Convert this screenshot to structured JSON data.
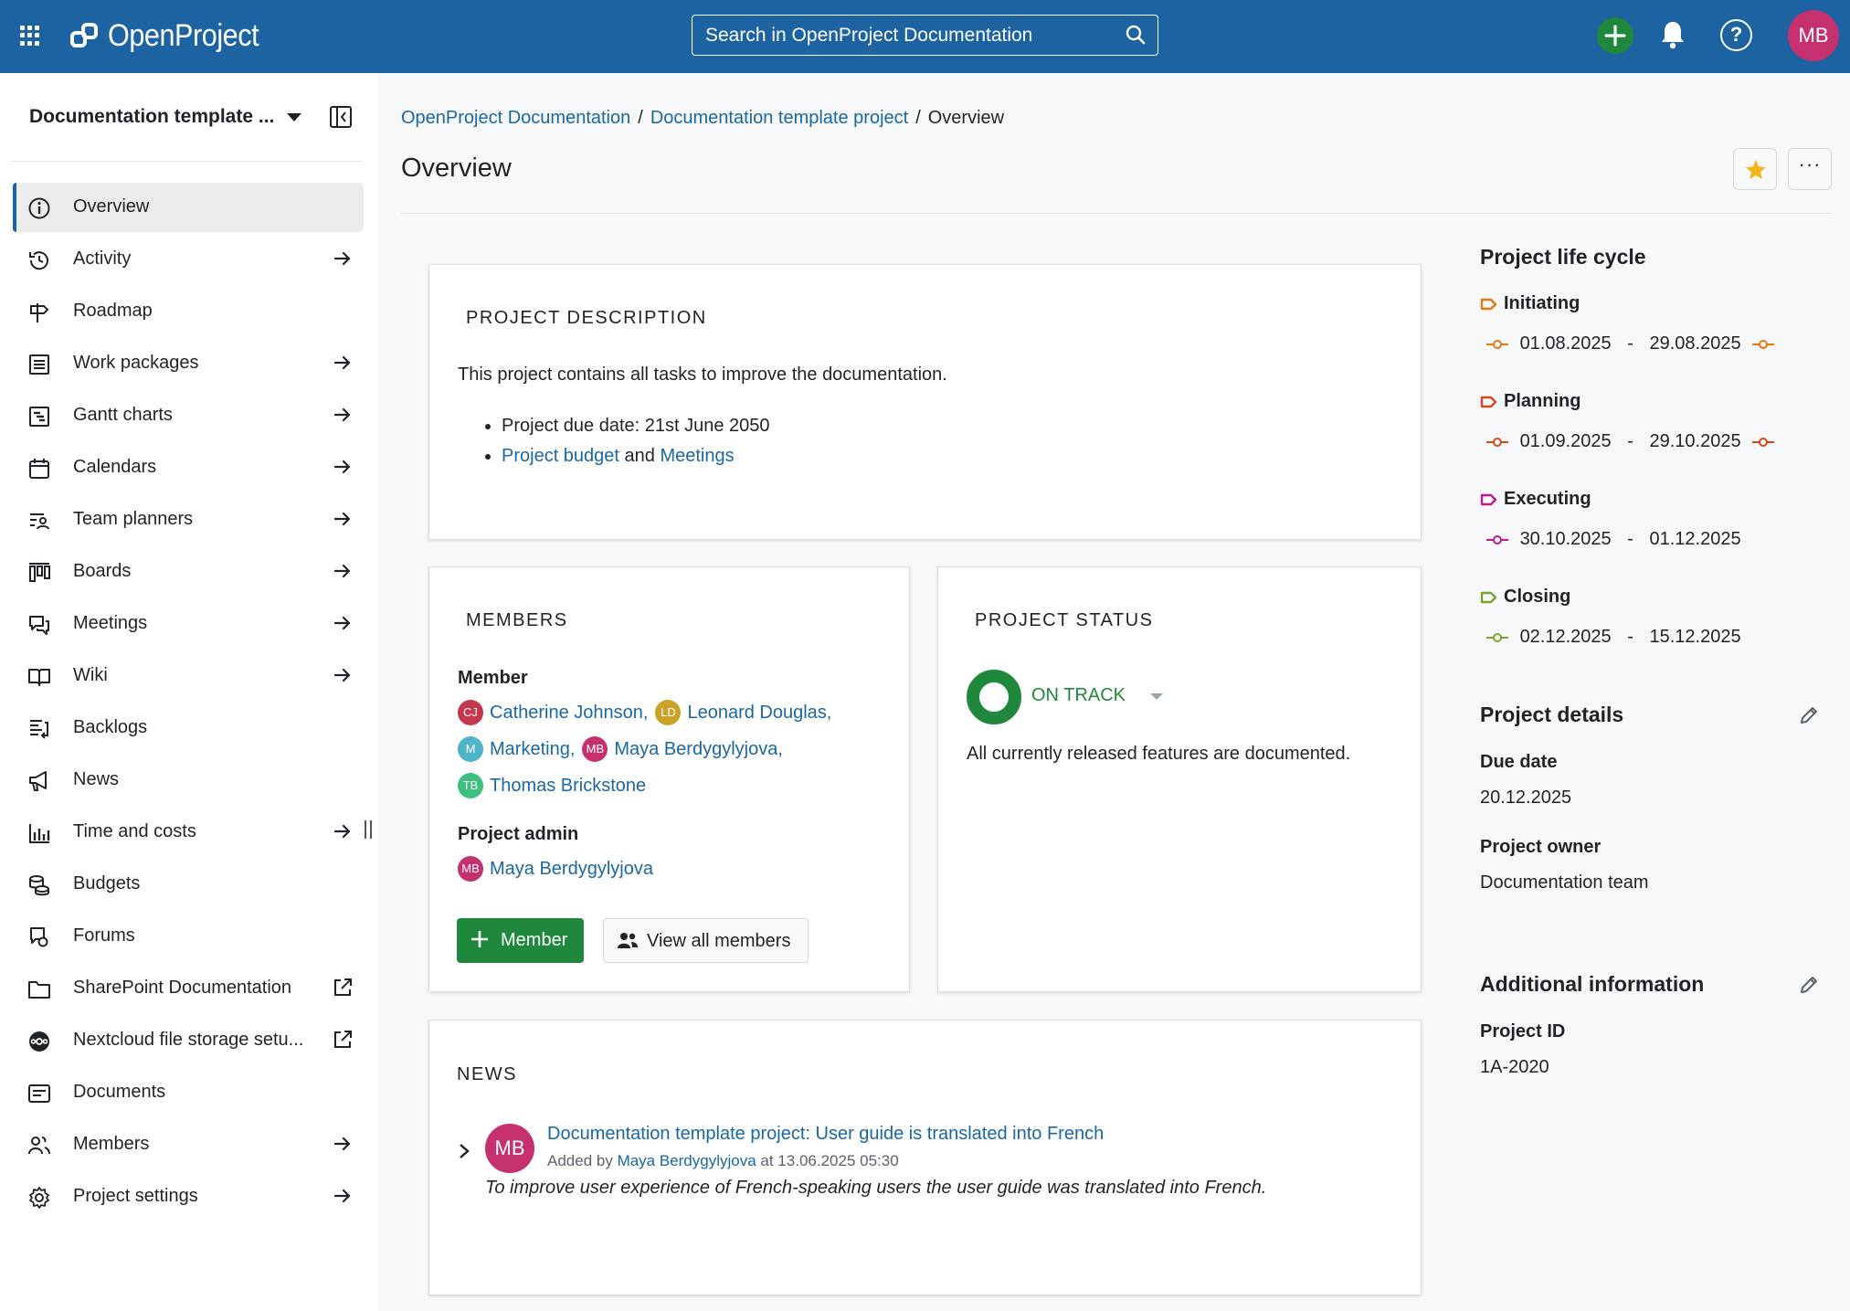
{
  "header": {
    "logo_text": "OpenProject",
    "search_placeholder": "Search in OpenProject Documentation",
    "user_initials": "MB",
    "help_glyph": "?",
    "colors": {
      "topbar": "#1e63a1",
      "create": "#1f883d",
      "avatar": "#c5306e"
    }
  },
  "sidebar": {
    "project_name": "Documentation template ...",
    "items": [
      {
        "label": "Overview",
        "icon": "info-icon",
        "active": true
      },
      {
        "label": "Activity",
        "icon": "history-icon",
        "arrow": true
      },
      {
        "label": "Roadmap",
        "icon": "signpost-icon"
      },
      {
        "label": "Work packages",
        "icon": "list-icon",
        "arrow": true
      },
      {
        "label": "Gantt charts",
        "icon": "gantt-icon",
        "arrow": true
      },
      {
        "label": "Calendars",
        "icon": "calendar-icon",
        "arrow": true
      },
      {
        "label": "Team planners",
        "icon": "team-planner-icon",
        "arrow": true
      },
      {
        "label": "Boards",
        "icon": "board-icon",
        "arrow": true
      },
      {
        "label": "Meetings",
        "icon": "meeting-icon",
        "arrow": true
      },
      {
        "label": "Wiki",
        "icon": "book-icon",
        "arrow": true
      },
      {
        "label": "Backlogs",
        "icon": "backlog-icon"
      },
      {
        "label": "News",
        "icon": "megaphone-icon"
      },
      {
        "label": "Time and costs",
        "icon": "bar-graph-icon",
        "arrow": true
      },
      {
        "label": "Budgets",
        "icon": "coins-icon"
      },
      {
        "label": "Forums",
        "icon": "forum-icon"
      },
      {
        "label": "SharePoint Documentation",
        "icon": "folder-icon",
        "external": true
      },
      {
        "label": "Nextcloud file storage setu...",
        "icon": "nextcloud-icon",
        "external": true
      },
      {
        "label": "Documents",
        "icon": "document-icon"
      },
      {
        "label": "Members",
        "icon": "members-icon",
        "arrow": true
      },
      {
        "label": "Project settings",
        "icon": "gear-icon",
        "arrow": true
      }
    ]
  },
  "breadcrumb": {
    "items": [
      "OpenProject Documentation",
      "Documentation template project"
    ],
    "current": "Overview",
    "separator": "/"
  },
  "page": {
    "title": "Overview",
    "more_glyph": "···"
  },
  "description": {
    "title": "PROJECT DESCRIPTION",
    "text": "This project contains all tasks to improve the documentation.",
    "due_item": "Project due date: 21st June 2050",
    "budget_link": "Project budget",
    "and_text": " and ",
    "meetings_link": "Meetings"
  },
  "members": {
    "title": "MEMBERS",
    "member_heading": "Member",
    "members": [
      {
        "initials": "CJ",
        "name": "Catherine Johnson",
        "color": "#c4384e"
      },
      {
        "initials": "LD",
        "name": "Leonard Douglas",
        "color": "#c9a227"
      },
      {
        "initials": "M",
        "name": "Marketing",
        "color": "#4fb3c9"
      },
      {
        "initials": "MB",
        "name": "Maya Berdygylyjova",
        "color": "#c5306e"
      },
      {
        "initials": "TB",
        "name": "Thomas Brickstone",
        "color": "#3fbf7f"
      }
    ],
    "comma": ",",
    "admin_heading": "Project admin",
    "admins": [
      {
        "initials": "MB",
        "name": "Maya Berdygylyjova",
        "color": "#c5306e"
      }
    ],
    "add_button": "Member",
    "view_all_button": "View all members"
  },
  "status": {
    "title": "PROJECT STATUS",
    "value": "ON TRACK",
    "color": "#1f883d",
    "explanation": "All currently released features are documented."
  },
  "news": {
    "title": "NEWS",
    "author_initials": "MB",
    "project_link": "Documentation template project",
    "colon": ": ",
    "headline": "User guide is translated into French",
    "added_by": "Added by ",
    "author": "Maya Berdygylyjova",
    "at_text": " at 13.06.2025 05:30",
    "summary": "To improve user experience of French-speaking users the user guide was translated into French."
  },
  "lifecycle": {
    "title": "Project life cycle",
    "dash": "-",
    "phases": [
      {
        "name": "Initiating",
        "start": "01.08.2025",
        "end": "29.08.2025",
        "color": "#e8760c"
      },
      {
        "name": "Planning",
        "start": "01.09.2025",
        "end": "29.10.2025",
        "color": "#d8461b"
      },
      {
        "name": "Executing",
        "start": "30.10.2025",
        "end": "01.12.2025",
        "color": "#c2198a"
      },
      {
        "name": "Closing",
        "start": "02.12.2025",
        "end": "15.12.2025",
        "color": "#78a62b"
      }
    ]
  },
  "details": {
    "title": "Project details",
    "due_label": "Due date",
    "due_value": "20.12.2025",
    "owner_label": "Project owner",
    "owner_value": "Documentation team"
  },
  "additional": {
    "title": "Additional information",
    "id_label": "Project ID",
    "id_value": "1A-2020"
  }
}
